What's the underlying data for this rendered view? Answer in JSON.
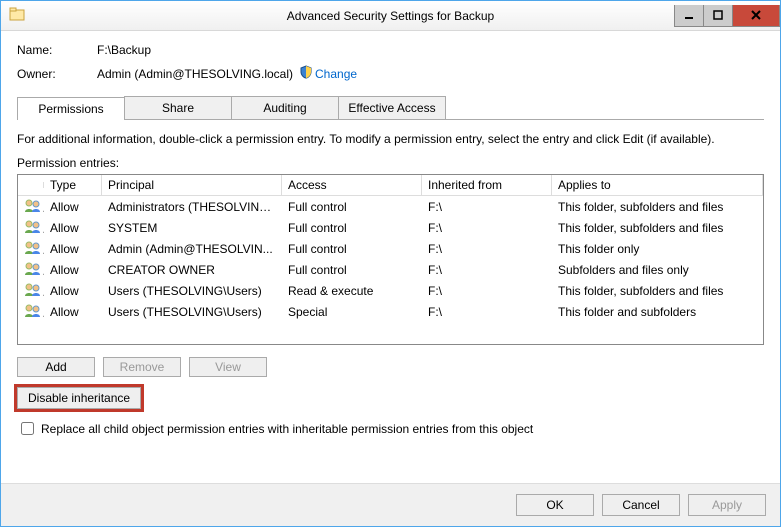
{
  "window": {
    "title": "Advanced Security Settings for Backup"
  },
  "header": {
    "name_label": "Name:",
    "name_value": "F:\\Backup",
    "owner_label": "Owner:",
    "owner_value": "Admin (Admin@THESOLVING.local)",
    "change_link": "Change"
  },
  "tabs": {
    "permissions": "Permissions",
    "share": "Share",
    "auditing": "Auditing",
    "effective": "Effective Access"
  },
  "info_text": "For additional information, double-click a permission entry. To modify a permission entry, select the entry and click Edit (if available).",
  "entries_label": "Permission entries:",
  "columns": {
    "type": "Type",
    "principal": "Principal",
    "access": "Access",
    "inherited": "Inherited from",
    "applies": "Applies to"
  },
  "entries": [
    {
      "type": "Allow",
      "principal": "Administrators (THESOLVING...",
      "access": "Full control",
      "inherited": "F:\\",
      "applies": "This folder, subfolders and files"
    },
    {
      "type": "Allow",
      "principal": "SYSTEM",
      "access": "Full control",
      "inherited": "F:\\",
      "applies": "This folder, subfolders and files"
    },
    {
      "type": "Allow",
      "principal": "Admin (Admin@THESOLVIN...",
      "access": "Full control",
      "inherited": "F:\\",
      "applies": "This folder only"
    },
    {
      "type": "Allow",
      "principal": "CREATOR OWNER",
      "access": "Full control",
      "inherited": "F:\\",
      "applies": "Subfolders and files only"
    },
    {
      "type": "Allow",
      "principal": "Users (THESOLVING\\Users)",
      "access": "Read & execute",
      "inherited": "F:\\",
      "applies": "This folder, subfolders and files"
    },
    {
      "type": "Allow",
      "principal": "Users (THESOLVING\\Users)",
      "access": "Special",
      "inherited": "F:\\",
      "applies": "This folder and subfolders"
    }
  ],
  "buttons": {
    "add": "Add",
    "remove": "Remove",
    "view": "View",
    "disable_inheritance": "Disable inheritance",
    "ok": "OK",
    "cancel": "Cancel",
    "apply": "Apply"
  },
  "checkbox_label": "Replace all child object permission entries with inheritable permission entries from this object"
}
